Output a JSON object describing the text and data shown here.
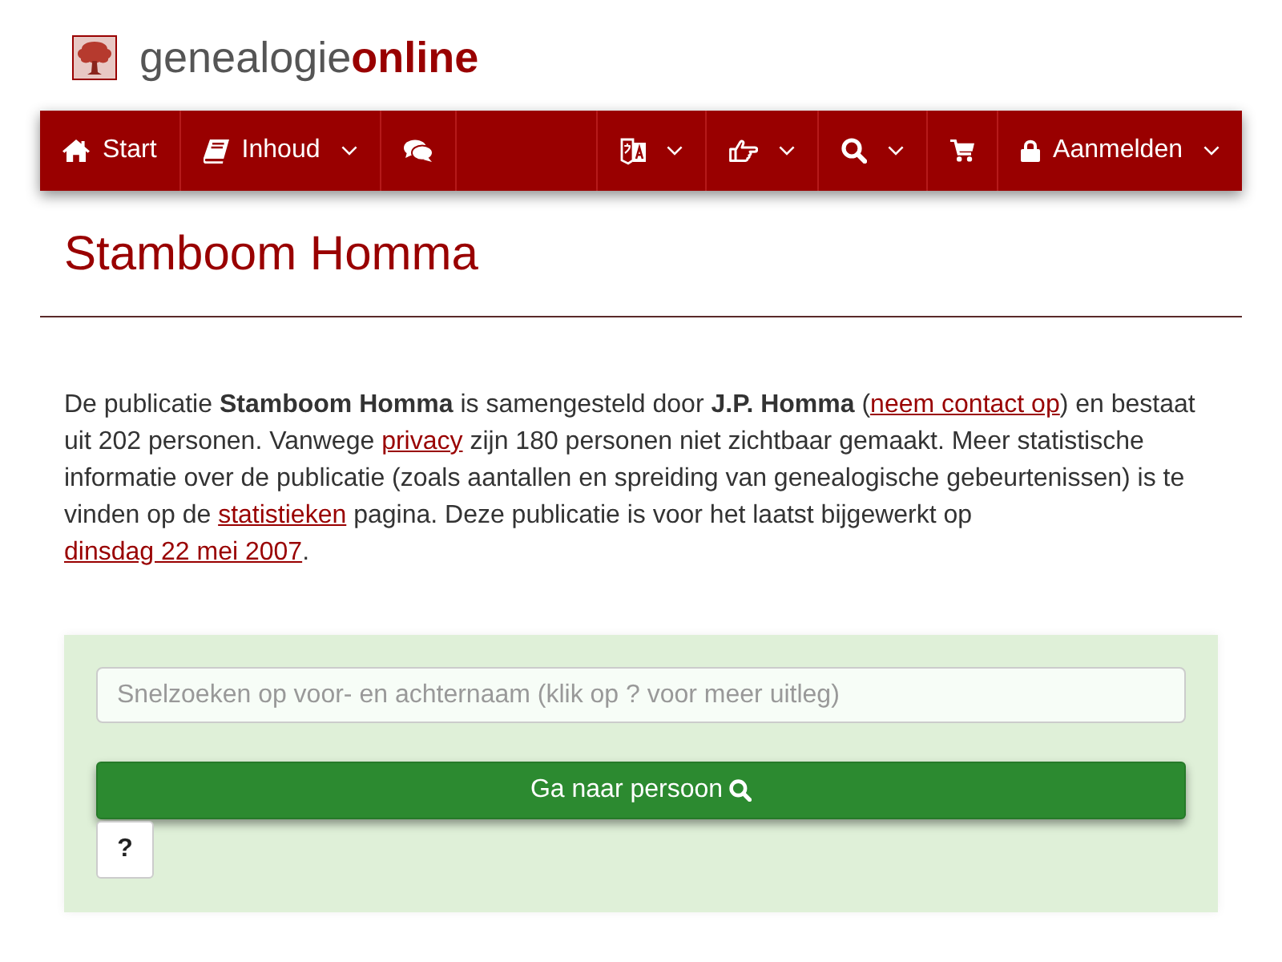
{
  "logo": {
    "text": "genealogie**online**"
  },
  "nav": {
    "left": [
      {
        "label": "Start",
        "dropdown": false
      },
      {
        "label": "Inhoud",
        "dropdown": true
      },
      {
        "dropdown": false
      }
    ],
    "right": [
      {
        "dropdown": true
      },
      {
        "dropdown": true
      },
      {
        "dropdown": true
      },
      {
        "dropdown": false
      },
      {
        "label": "Aanmelden",
        "dropdown": true
      }
    ]
  },
  "title": "Stamboom Homma",
  "intro": [
    {
      "kind": "text",
      "text": "De publicatie **Stamboom Homma** is samengesteld door **J.P. Homma** ("
    },
    {
      "kind": "link",
      "text": "neem contact op"
    },
    {
      "kind": "text",
      "text": ") en bestaat uit 202 personen. Vanwege "
    },
    {
      "kind": "link",
      "text": "privacy"
    },
    {
      "kind": "text",
      "text": " zijn 180 personen niet zichtbaar gemaakt. Meer statistische informatie over de publicatie (zoals aantallen en spreiding van genealogische gebeurtenissen) is te vinden op de "
    },
    {
      "kind": "link",
      "text": "statistieken"
    },
    {
      "kind": "text",
      "text": " pagina. Deze publicatie is voor het laatst bijgewerkt op "
    },
    {
      "kind": "link",
      "text": "dinsdag 22 mei 2007"
    },
    {
      "kind": "text",
      "text": "."
    }
  ],
  "quick_search": {
    "placeholder": "Snelzoeken op voor- en achternaam (klik op ? voor meer uitleg)",
    "submit": "Ga naar persoon",
    "help": "?"
  }
}
